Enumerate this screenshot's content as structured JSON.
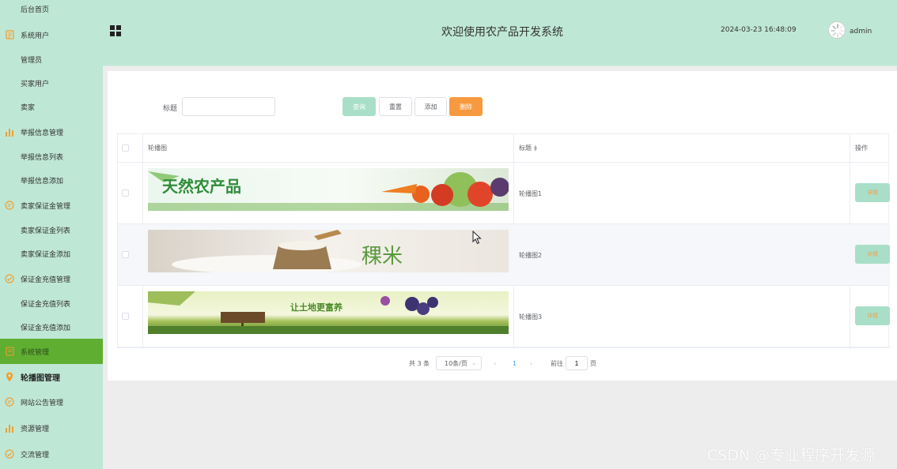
{
  "sidebar": {
    "items": [
      {
        "label": "后台首页",
        "type": "sub"
      },
      {
        "label": "系统用户",
        "type": "parent",
        "icon": "document-icon"
      },
      {
        "label": "管理员",
        "type": "sub"
      },
      {
        "label": "买家用户",
        "type": "sub"
      },
      {
        "label": "卖家",
        "type": "sub"
      },
      {
        "label": "举报信息管理",
        "type": "parent",
        "icon": "bar-chart-icon"
      },
      {
        "label": "举报信息列表",
        "type": "sub"
      },
      {
        "label": "举报信息添加",
        "type": "sub"
      },
      {
        "label": "卖家保证金管理",
        "type": "parent",
        "icon": "chat-icon"
      },
      {
        "label": "卖家保证金列表",
        "type": "sub"
      },
      {
        "label": "卖家保证金添加",
        "type": "sub"
      },
      {
        "label": "保证金充值管理",
        "type": "parent",
        "icon": "check-circle-icon"
      },
      {
        "label": "保证金充值列表",
        "type": "sub"
      },
      {
        "label": "保证金充值添加",
        "type": "sub"
      },
      {
        "label": "系统管理",
        "type": "parent",
        "icon": "document-icon",
        "active": true
      },
      {
        "label": "轮播图管理",
        "type": "parent",
        "icon": "location-pin-icon",
        "bold": true
      },
      {
        "label": "网站公告管理",
        "type": "parent",
        "icon": "chat-icon"
      },
      {
        "label": "资源管理",
        "type": "parent",
        "icon": "bar-chart-icon"
      },
      {
        "label": "交流管理",
        "type": "parent",
        "icon": "check-circle-icon"
      }
    ]
  },
  "header": {
    "title": "欢迎使用农产品开发系统",
    "datetime": "2024-03-23 16:48:09",
    "username": "admin"
  },
  "search": {
    "label": "标题",
    "value": "",
    "placeholder": ""
  },
  "toolbar": {
    "query_label": "查询",
    "reset_label": "重置",
    "add_label": "添加",
    "delete_label": "删除"
  },
  "table": {
    "columns": {
      "image": "轮播图",
      "title": "标题",
      "actions": "操作"
    },
    "rows": [
      {
        "title": "轮播图1",
        "action": "详情",
        "banner_text": "天然农产品"
      },
      {
        "title": "轮播图2",
        "action": "详情",
        "banner_text": "稞米"
      },
      {
        "title": "轮播图3",
        "action": "详情",
        "banner_text": "让土地更富养"
      }
    ]
  },
  "pagination": {
    "total": "共 3 条",
    "page_size": "10条/页",
    "current_page": "1",
    "goto_prefix": "前往",
    "goto_value": "1",
    "goto_suffix": "页"
  },
  "watermark": "CSDN @专业程序开发源",
  "colors": {
    "sidebar_bg": "#bfe7d6",
    "active_item": "#5fae32",
    "query_button": "#a9dfc9",
    "delete_button": "#f79a3f",
    "icon_accent": "#f0a030"
  }
}
